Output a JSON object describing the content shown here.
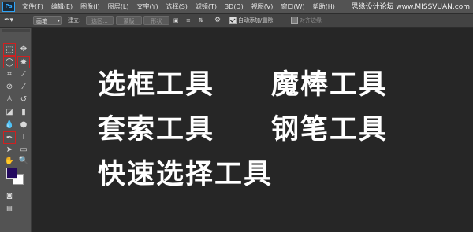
{
  "app": {
    "logo": "Ps"
  },
  "menu": [
    "文件(F)",
    "编辑(E)",
    "图像(I)",
    "图层(L)",
    "文字(Y)",
    "选择(S)",
    "滤镜(T)",
    "3D(D)",
    "视图(V)",
    "窗口(W)",
    "帮助(H)"
  ],
  "watermark": "思缘设计论坛 www.MISSVUAN.com",
  "options": {
    "mode_value": "画笔",
    "make_label": "建立:",
    "selection_button": "选区...",
    "mask_button": "蒙版",
    "shape_button": "形状",
    "auto_add_delete": "自动添加/删除",
    "align_edges": "对齐边缘"
  },
  "colors": {
    "foreground": "#240a5e",
    "background": "#ffffff",
    "highlight": "#d02020"
  },
  "labels": {
    "marquee": "选框工具",
    "magic_wand": "魔棒工具",
    "lasso": "套索工具",
    "pen": "钢笔工具",
    "quick_select": "快速选择工具"
  }
}
